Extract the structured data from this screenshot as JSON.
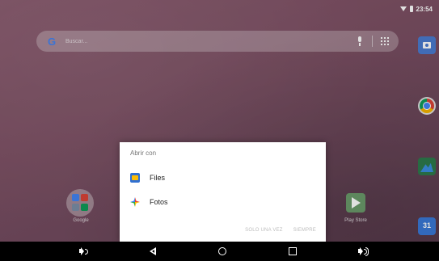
{
  "status_bar": {
    "time": "23:54",
    "icons": [
      "wifi-icon",
      "battery-icon"
    ]
  },
  "search": {
    "placeholder": "Buscar..."
  },
  "home": {
    "folder_label": "Google",
    "playstore_label": "Play Store",
    "calendar_day": "31"
  },
  "dock": [
    "camera-icon",
    "chrome-icon",
    "gallery-icon",
    "calendar-icon"
  ],
  "dialog": {
    "title": "Abrir con",
    "items": [
      {
        "label": "Files",
        "icon": "files-icon"
      },
      {
        "label": "Fotos",
        "icon": "photos-icon"
      }
    ],
    "actions": {
      "once": "SOLO UNA VEZ",
      "always": "SIEMPRE"
    }
  },
  "nav_bar": [
    "volume-down-icon",
    "back-icon",
    "home-icon",
    "recents-icon",
    "volume-up-icon"
  ]
}
